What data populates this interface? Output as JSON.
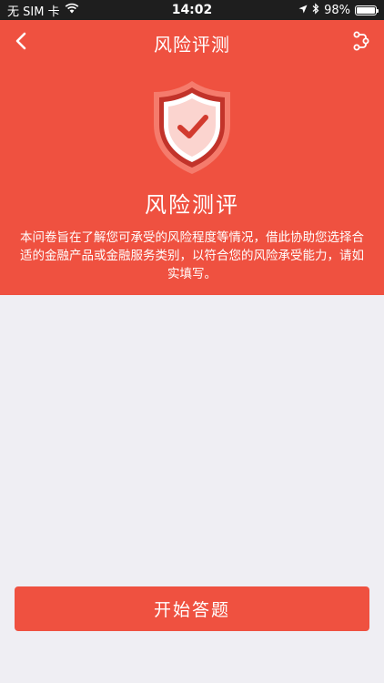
{
  "status_bar": {
    "carrier": "无 SIM 卡",
    "time": "14:02",
    "battery_level": "98%",
    "battery_fraction": 0.98,
    "icons": [
      "wifi-icon",
      "location-arrow-icon",
      "bluetooth-icon",
      "battery-icon"
    ]
  },
  "nav": {
    "title": "风险评测",
    "left_icon": "chevron-left-icon",
    "right_icon": "share-icon"
  },
  "hero": {
    "icon": "shield-check-icon",
    "title": "风险测评",
    "description": "本问卷旨在了解您可承受的风险程度等情况，借此协助您选择合适的金融产品或金融服务类别，以符合您的风险承受能力，请如实填写。"
  },
  "actions": {
    "start_label": "开始答题"
  },
  "colors": {
    "accent": "#ef5140",
    "background": "#efeef3",
    "status_bar": "#1e1e1e"
  }
}
